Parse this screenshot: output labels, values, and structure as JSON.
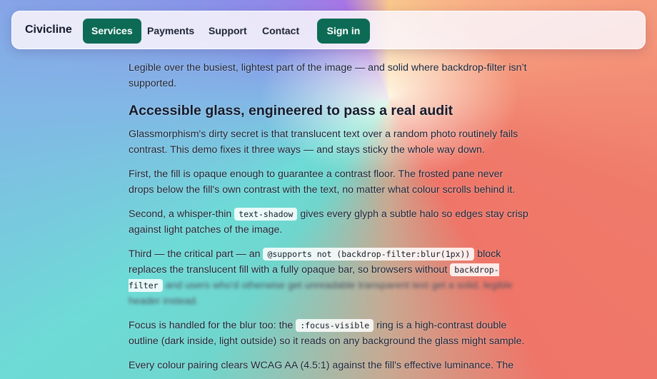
{
  "nav": {
    "brand": "Civicline",
    "links": [
      "Services",
      "Payments",
      "Support",
      "Contact"
    ],
    "signin": "Sign in"
  },
  "content": {
    "intro": "Legible over the busiest, lightest part of the image — and solid where backdrop-filter isn’t supported.",
    "heading": "Accessible glass, engineered to pass a real audit",
    "p1": "Glassmorphism's dirty secret is that translucent text over a random photo routinely fails contrast. This demo fixes it three ways — and stays sticky the whole way down.",
    "p2": "First, the fill is opaque enough to guarantee a contrast floor. The frosted pane never drops below the fill's own contrast with the text, no matter what colour scrolls behind it.",
    "p3_a": "Second, a whisper-thin ",
    "p3_code": "text-shadow",
    "p3_b": " gives every glyph a subtle halo so edges stay crisp against light patches of the image.",
    "p4_a": "Third — the critical part — an ",
    "p4_code": "@supports not (backdrop-filter:blur(1px))",
    "p4_b": " block replaces the translucent fill with a fully opaque bar, so browsers without ",
    "p4_code2": "backdrop-filter",
    "p4_c": " and users who'd otherwise get unreadable transparent text get a solid, legible header instead.",
    "p5_a": "Focus is handled for the blur too: the ",
    "p5_code": ":focus-visible",
    "p5_b": " ring is a high-contrast double outline (dark inside, light outside) so it reads on any background the glass might sample.",
    "p6": "Every colour pairing clears WCAG AA (4.5:1) against the fill's effective luminance. The"
  }
}
